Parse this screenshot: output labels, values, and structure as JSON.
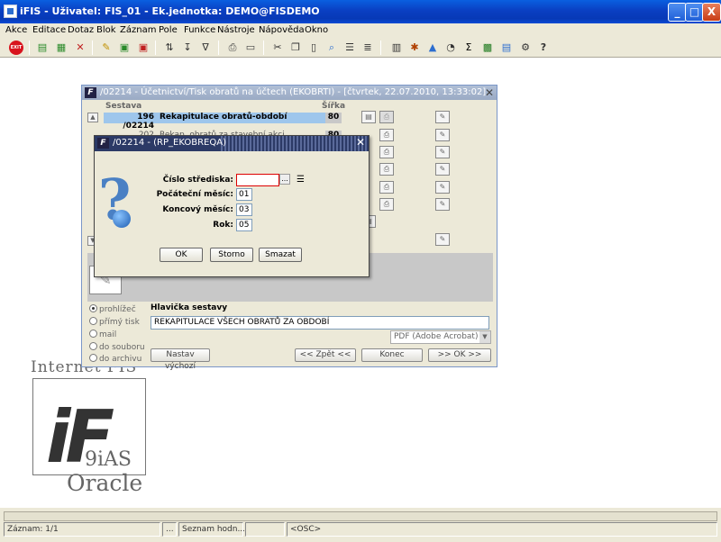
{
  "window": {
    "title": "iFIS - Uživatel: FIS_01 - Ek.jednotka: DEMO@FISDEMO",
    "min": "_",
    "max": "□",
    "close": "X"
  },
  "menu": [
    "Akce",
    "Editace",
    "Dotaz",
    "Blok",
    "Záznam",
    "Pole",
    "Funkce",
    "Nástroje",
    "Nápověda",
    "Okno"
  ],
  "toolbar": {
    "stop_label": "EXIT"
  },
  "logo": {
    "line1": "Internet FIS",
    "letters": "iF",
    "line2": "9iAS",
    "line3": "Oracle"
  },
  "form": {
    "title": "/02214 - Účetnictví/Tisk obratů na účtech (EKOBRTI) - [čtvrtek, 22.07.2010, 13:33:02]",
    "close": "✕",
    "col_sestava": "Sestava",
    "col_sirka": "Šířka",
    "rows": [
      {
        "num": "196 /02214",
        "name": "Rekapitulace obratů-období",
        "width": "80"
      },
      {
        "num": "202 /02214",
        "name": "Rekap. obratů za stavební akci",
        "width": "80"
      }
    ],
    "header_label": "Hlavička sestavy",
    "header_value": "REKAPITULACE VŠECH OBRATŮ ZA OBDOBÍ",
    "output_options": [
      "prohlížeč",
      "přímý tisk",
      "mail",
      "do souboru",
      "do archivu"
    ],
    "output_selected": 0,
    "format": "PDF (Adobe Acrobat)",
    "btn_defaults": "Nastav výchozí",
    "btn_back": "<< Zpět <<",
    "btn_end": "Konec",
    "btn_ok": ">> OK >>"
  },
  "dialog": {
    "title": "/02214 - (RP_EKOBREQA)",
    "close": "✕",
    "fields": [
      {
        "label": "Číslo střediska:",
        "value": ""
      },
      {
        "label": "Počáteční měsíc:",
        "value": "01"
      },
      {
        "label": "Koncový měsíc:",
        "value": "03"
      },
      {
        "label": "Rok:",
        "value": "05"
      }
    ],
    "lov": "...",
    "btn_ok": "OK",
    "btn_storno": "Storno",
    "btn_smazat": "Smazat"
  },
  "status": {
    "zaznam": "Záznam: 1/1",
    "f2": "...",
    "seznam": "Seznam hodn...",
    "osc": "<OSC>"
  }
}
